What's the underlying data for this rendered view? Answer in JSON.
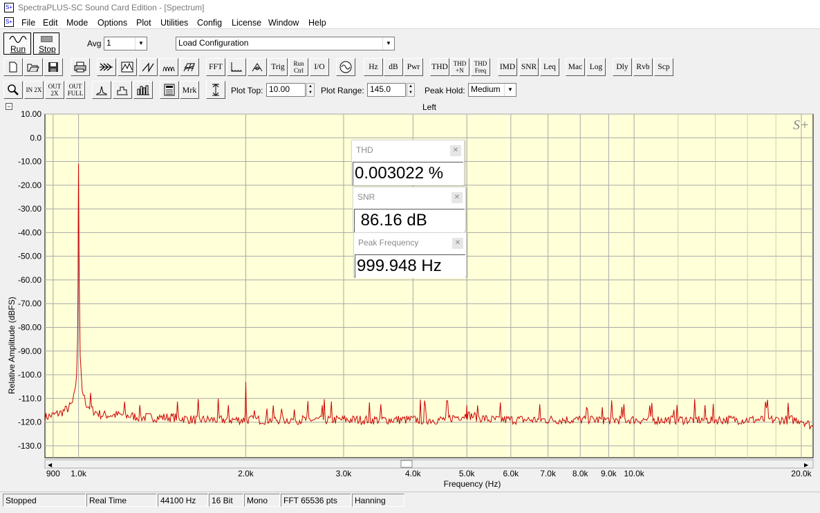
{
  "window": {
    "title": "SpectraPLUS-SC Sound Card Edition - [Spectrum]"
  },
  "menu": [
    "File",
    "Edit",
    "Mode",
    "Options",
    "Plot",
    "Utilities",
    "Config",
    "License",
    "Window",
    "Help"
  ],
  "toolbar1": {
    "run_label": "Run",
    "stop_label": "Stop",
    "avg_label": "Avg",
    "avg_value": "1",
    "config_value": "Load Configuration"
  },
  "toolbar2": {
    "buttons": [
      "FFT",
      "Trig",
      "Run\nCtrl",
      "I/O",
      "Hz",
      "dB",
      "Pwr",
      "THD",
      "THD\n+N",
      "THD\nFreq",
      "IMD",
      "SNR",
      "Leq",
      "Mac",
      "Log",
      "Dly",
      "Rvb",
      "Scp"
    ]
  },
  "toolbar3": {
    "zoom_buttons": [
      "IN 2X",
      "OUT 2X",
      "OUT FULL"
    ],
    "mrk_label": "Mrk",
    "plot_top_label": "Plot Top:",
    "plot_top_value": "10.00",
    "plot_range_label": "Plot Range:",
    "plot_range_value": "145.0",
    "peak_hold_label": "Peak Hold:",
    "peak_hold_value": "Medium"
  },
  "plot": {
    "channel_title": "Left",
    "watermark": "S+",
    "collapse_symbol": "−"
  },
  "meters": [
    {
      "title": "THD",
      "value": "0.003022 %"
    },
    {
      "title": "SNR",
      "value": " 86.16 dB"
    },
    {
      "title": "Peak Frequency",
      "value": "999.948 Hz"
    }
  ],
  "status": {
    "state": "Stopped",
    "mode": "Real Time",
    "rate": "44100 Hz",
    "bits": "16 Bit",
    "channels": "Mono",
    "fft": "FFT 65536 pts",
    "window": "Hanning"
  },
  "colors": {
    "plot_bg": "#ffffd8",
    "trace": "#cc0000",
    "grid": "#a8a8a8",
    "accent": "#0000cc"
  },
  "chart_data": {
    "type": "line",
    "title": "Left",
    "xlabel": "Frequency (Hz)",
    "ylabel": "Relative Amplitude (dBFS)",
    "x_scale": "log",
    "xlim": [
      870,
      21000
    ],
    "ylim": [
      -135,
      10
    ],
    "y_ticks": [
      "10.00",
      "0.0",
      "-10.00",
      "-20.00",
      "-30.00",
      "-40.00",
      "-50.00",
      "-60.00",
      "-70.00",
      "-80.00",
      "-90.00",
      "-100.0",
      "-110.0",
      "-120.0",
      "-130.0"
    ],
    "x_ticks": [
      {
        "value": 900,
        "label": "900"
      },
      {
        "value": 1000,
        "label": "1.0k"
      },
      {
        "value": 2000,
        "label": "2.0k"
      },
      {
        "value": 3000,
        "label": "3.0k"
      },
      {
        "value": 4000,
        "label": "4.0k"
      },
      {
        "value": 5000,
        "label": "5.0k"
      },
      {
        "value": 6000,
        "label": "6.0k"
      },
      {
        "value": 7000,
        "label": "7.0k"
      },
      {
        "value": 8000,
        "label": "8.0k"
      },
      {
        "value": 9000,
        "label": "9.0k"
      },
      {
        "value": 10000,
        "label": "10.0k"
      },
      {
        "value": 20000,
        "label": "20.0k"
      }
    ],
    "series": [
      {
        "x": [
          870,
          900,
          930,
          960,
          975,
          985,
          992,
          996,
          998,
          999,
          1000,
          1001,
          1003,
          1007,
          1015,
          1030,
          1060,
          1100,
          1200,
          1300,
          1400,
          1500,
          1600,
          1700,
          1800,
          1900,
          1990,
          1995,
          2000,
          2005,
          2010,
          2100,
          2300,
          2500,
          2700,
          3000,
          3500,
          4000,
          4500,
          4990,
          5000,
          5010,
          5500,
          6000,
          7000,
          8000,
          9000,
          10000,
          12000,
          15000,
          18000,
          20000,
          21000
        ],
        "y": [
          -118,
          -117,
          -116,
          -114,
          -112,
          -108,
          -100,
          -85,
          -60,
          -30,
          -11,
          -30,
          -60,
          -92,
          -106,
          -112,
          -115,
          -117,
          -117,
          -118,
          -118,
          -118,
          -119,
          -119,
          -119,
          -119,
          -119,
          -115,
          -103,
          -115,
          -119,
          -119,
          -119,
          -119,
          -119,
          -119,
          -119,
          -119,
          -119,
          -117,
          -111,
          -117,
          -119,
          -119,
          -119,
          -119,
          -119,
          -119,
          -119,
          -119,
          -119,
          -119,
          -122
        ]
      }
    ]
  }
}
